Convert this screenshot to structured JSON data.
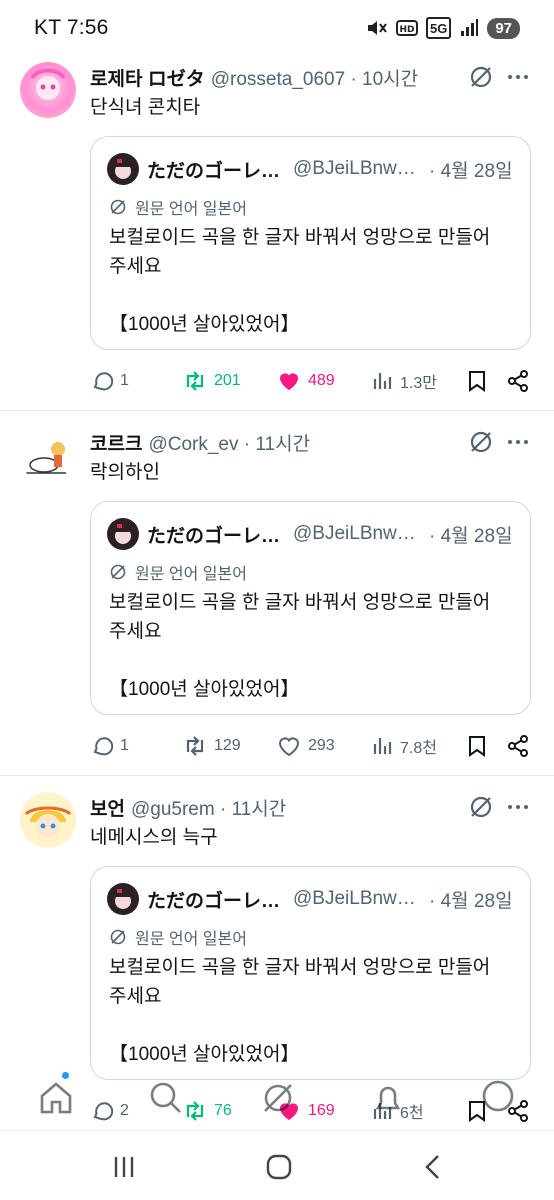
{
  "status_bar": {
    "carrier_time": "KT 7:56",
    "network": "5G",
    "battery": "97"
  },
  "tweets": [
    {
      "name": "로제타 ロゼタ",
      "handle": "@rosseta_0607 · 10시간",
      "text": "단식녀 콘치타",
      "quote": {
        "name": "ただのゴーレ…",
        "handle": "@BJeiLBnw…",
        "date": "· 4월 28일",
        "translate_label": "원문 언어 일본어",
        "line1": "보컬로이드 곡을 한 글자 바꿔서 엉망으로 만들어",
        "line2": "주세요",
        "line3": "【1000년 살아있었어】"
      },
      "replies": "1",
      "retweets": "201",
      "likes": "489",
      "views": "1.3만",
      "retweet_active": true,
      "like_active": true
    },
    {
      "name": "코르크",
      "handle": "@Cork_ev · 11시간",
      "text": "락의하인",
      "quote": {
        "name": "ただのゴーレ…",
        "handle": "@BJeiLBnw…",
        "date": "· 4월 28일",
        "translate_label": "원문 언어 일본어",
        "line1": "보컬로이드 곡을 한 글자 바꿔서 엉망으로 만들어",
        "line2": "주세요",
        "line3": "【1000년 살아있었어】"
      },
      "replies": "1",
      "retweets": "129",
      "likes": "293",
      "views": "7.8천",
      "retweet_active": false,
      "like_active": false
    },
    {
      "name": "보언",
      "handle": "@gu5rem · 11시간",
      "text": "네메시스의 늑구",
      "quote": {
        "name": "ただのゴーレ…",
        "handle": "@BJeiLBnw…",
        "date": "· 4월 28일",
        "translate_label": "원문 언어 일본어",
        "line1": "보컬로이드 곡을 한 글자 바꿔서 엉망으로 만들어",
        "line2": "주세요",
        "line3": "【1000년 살아있었어】"
      },
      "replies": "2",
      "retweets": "76",
      "likes": "169",
      "views": "6천",
      "retweet_active": true,
      "like_active": true
    }
  ],
  "bottom_nav": [
    "home-icon",
    "search-icon",
    "grok-icon",
    "notifications-icon",
    "messages-icon"
  ],
  "colors": {
    "retweet_active": "#00ba7c",
    "like_active": "#f91880",
    "muted": "#536471",
    "accent": "#1d9bf0"
  }
}
